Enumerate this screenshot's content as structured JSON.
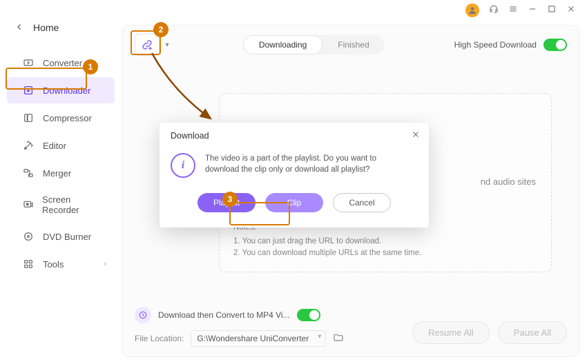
{
  "titlebar": {
    "avatar_icon": "user-icon",
    "support_icon": "headset-icon",
    "menu_icon": "hamburger-icon",
    "min_icon": "minimize-icon",
    "max_icon": "maximize-icon",
    "close_icon": "close-icon"
  },
  "sidebar": {
    "back_label": "Home",
    "items": [
      {
        "icon": "converter-icon",
        "label": "Converter",
        "active": false
      },
      {
        "icon": "downloader-icon",
        "label": "Downloader",
        "active": true
      },
      {
        "icon": "compressor-icon",
        "label": "Compressor",
        "active": false
      },
      {
        "icon": "editor-icon",
        "label": "Editor",
        "active": false
      },
      {
        "icon": "merger-icon",
        "label": "Merger",
        "active": false
      },
      {
        "icon": "screen-recorder-icon",
        "label": "Screen Recorder",
        "active": false
      },
      {
        "icon": "dvd-burner-icon",
        "label": "DVD Burner",
        "active": false
      },
      {
        "icon": "tools-icon",
        "label": "Tools",
        "active": false,
        "expandable": true
      }
    ]
  },
  "toolbar": {
    "url_button_icon": "link-add-icon",
    "tabs": {
      "downloading": "Downloading",
      "finished": "Finished",
      "active": "downloading"
    },
    "hsd_label": "High Speed Download",
    "hsd_on": true
  },
  "dropzone": {
    "sites_hint_suffix": "nd audio sites",
    "notes_header": "Notes:",
    "note1": "1. You can just drag the URL to download.",
    "note2": "2. You can download multiple URLs at the same time."
  },
  "bottom": {
    "convert_label": "Download then Convert to MP4 Vi...",
    "convert_on": true,
    "file_location_label": "File Location:",
    "file_location_path": "G:\\Wondershare UniConverter",
    "resume_all": "Resume All",
    "pause_all": "Pause All"
  },
  "modal": {
    "title": "Download",
    "message": "The video is a part of the playlist. Do you want to download the clip only or download all playlist?",
    "playlist_btn": "Playlist",
    "clip_btn": "Clip",
    "cancel_btn": "Cancel"
  },
  "annotations": {
    "badge1": "1",
    "badge2": "2",
    "badge3": "3"
  }
}
